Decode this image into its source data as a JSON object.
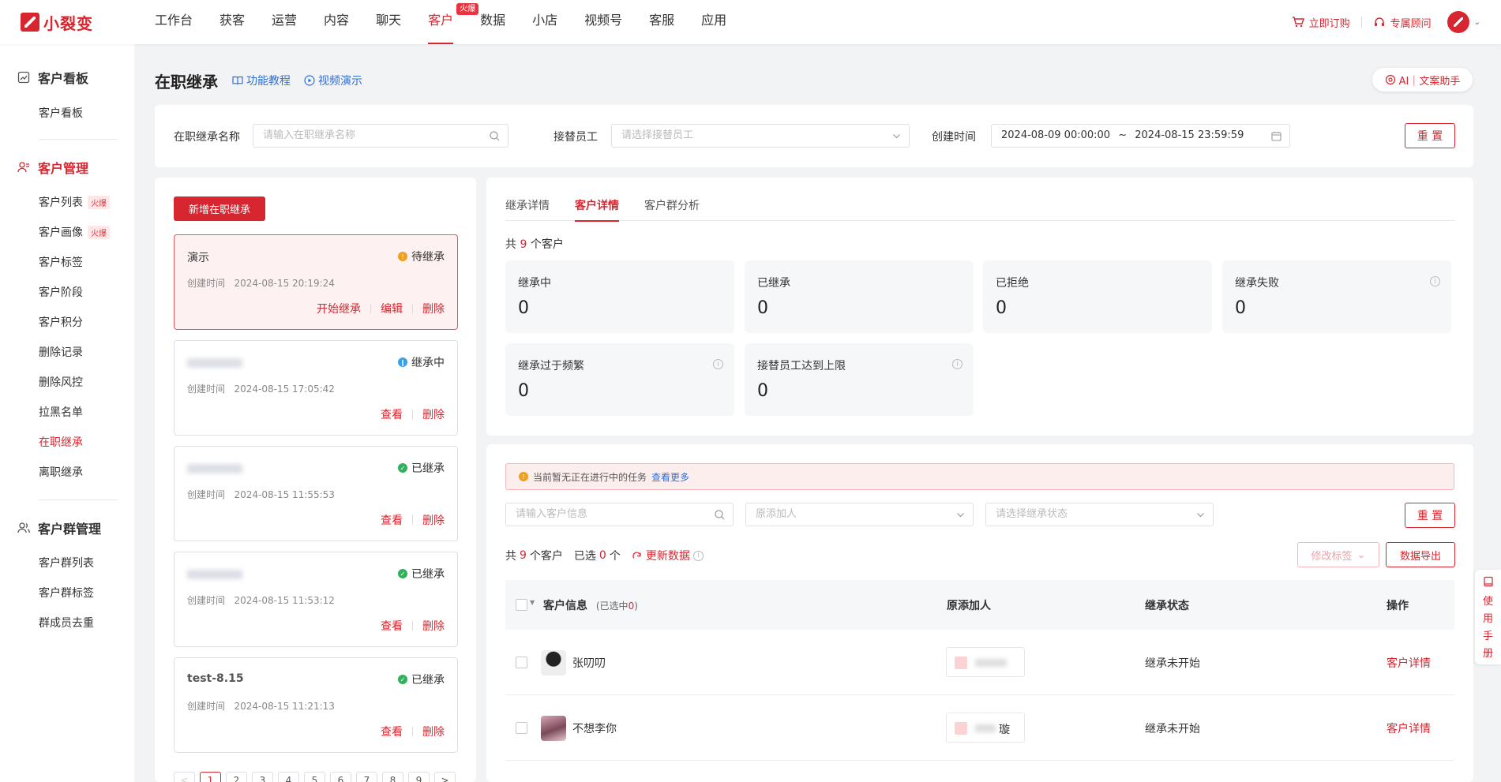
{
  "brand": {
    "name": "小裂变"
  },
  "nav": {
    "items": [
      "工作台",
      "获客",
      "运营",
      "内容",
      "聊天",
      "客户",
      "数据",
      "小店",
      "视频号",
      "客服",
      "应用"
    ],
    "active_index": 5,
    "hot_badge": "火爆"
  },
  "top_right": {
    "order": "立即订购",
    "advisor": "专属顾问"
  },
  "sidebar": {
    "group1": {
      "title": "客户看板",
      "items": [
        "客户看板"
      ]
    },
    "group2": {
      "title": "客户管理",
      "items": [
        "客户列表",
        "客户画像",
        "客户标签",
        "客户阶段",
        "客户积分",
        "删除记录",
        "删除风控",
        "拉黑名单",
        "在职继承",
        "离职继承"
      ],
      "hot_tag": "火爆",
      "active": "在职继承"
    },
    "group3": {
      "title": "客户群管理",
      "items": [
        "客户群列表",
        "客户群标签",
        "群成员去重"
      ]
    }
  },
  "page": {
    "title": "在职继承",
    "tutorial": "功能教程",
    "video": "视频演示",
    "ai_btn": "AI｜文案助手"
  },
  "filters": {
    "name_label": "在职继承名称",
    "name_placeholder": "请输入在职继承名称",
    "staff_label": "接替员工",
    "staff_placeholder": "请选择接替员工",
    "time_label": "创建时间",
    "time_start": "2024-08-09 00:00:00",
    "time_sep": "~",
    "time_end": "2024-08-15 23:59:59",
    "reset": "重 置"
  },
  "tasks": {
    "new_btn": "新增在职继承",
    "time_label": "创建时间",
    "list": [
      {
        "name": "演示",
        "status": "待继承",
        "time": "2024-08-15 20:19:24",
        "actions": [
          "开始继承",
          "编辑",
          "删除"
        ]
      },
      {
        "name": "",
        "status": "继承中",
        "time": "2024-08-15 17:05:42",
        "actions": [
          "查看",
          "删除"
        ]
      },
      {
        "name": "",
        "status": "已继承",
        "time": "2024-08-15 11:55:53",
        "actions": [
          "查看",
          "删除"
        ]
      },
      {
        "name": "",
        "status": "已继承",
        "time": "2024-08-15 11:53:12",
        "actions": [
          "查看",
          "删除"
        ]
      },
      {
        "name": "test-8.15",
        "status": "已继承",
        "time": "2024-08-15 11:21:13",
        "actions": [
          "查看",
          "删除"
        ]
      }
    ],
    "pages": [
      "<",
      "1",
      "2",
      "3",
      "4",
      "5",
      "6",
      "7",
      "8",
      "9",
      ">"
    ]
  },
  "detail": {
    "tabs": [
      "继承详情",
      "客户详情",
      "客户群分析"
    ],
    "active_tab": 1,
    "total_prefix": "共",
    "total_count": "9",
    "total_suffix": "个客户",
    "stats": [
      {
        "label": "继承中",
        "value": "0"
      },
      {
        "label": "已继承",
        "value": "0"
      },
      {
        "label": "已拒绝",
        "value": "0"
      },
      {
        "label": "继承失败",
        "value": "0"
      },
      {
        "label": "继承过于频繁",
        "value": "0"
      },
      {
        "label": "接替员工达到上限",
        "value": "0"
      }
    ]
  },
  "customers": {
    "notice": "当前暂无正在进行中的任务",
    "notice_more": "查看更多",
    "search_placeholder": "请输入客户信息",
    "adder_placeholder": "原添加人",
    "status_placeholder": "请选择继承状态",
    "reset": "重 置",
    "total_prefix": "共",
    "total_count": "9",
    "total_suffix": "个客户",
    "selected_prefix": "已选",
    "selected_count": "0",
    "selected_suffix": "个",
    "refresh": "更新数据",
    "modify_tag": "修改标签",
    "export": "数据导出",
    "columns": {
      "info": "客户信息",
      "info_sub_prefix": "(已选中",
      "info_sub_count": "0",
      "info_sub_suffix": ")",
      "adder": "原添加人",
      "status": "继承状态",
      "action": "操作"
    },
    "rows": [
      {
        "name": "张叨叨",
        "adder_tail": "",
        "status": "继承未开始",
        "action": "客户详情"
      },
      {
        "name": "不想李你",
        "adder_tail": "璇",
        "status": "继承未开始",
        "action": "客户详情"
      }
    ]
  },
  "float": {
    "manual": [
      "使",
      "用",
      "手",
      "册"
    ]
  },
  "colors": {
    "brand": "#d7262f",
    "link": "#2f6fd6",
    "pending": "#f0a020",
    "in_progress": "#3aa0e8",
    "done": "#2fb35a"
  }
}
